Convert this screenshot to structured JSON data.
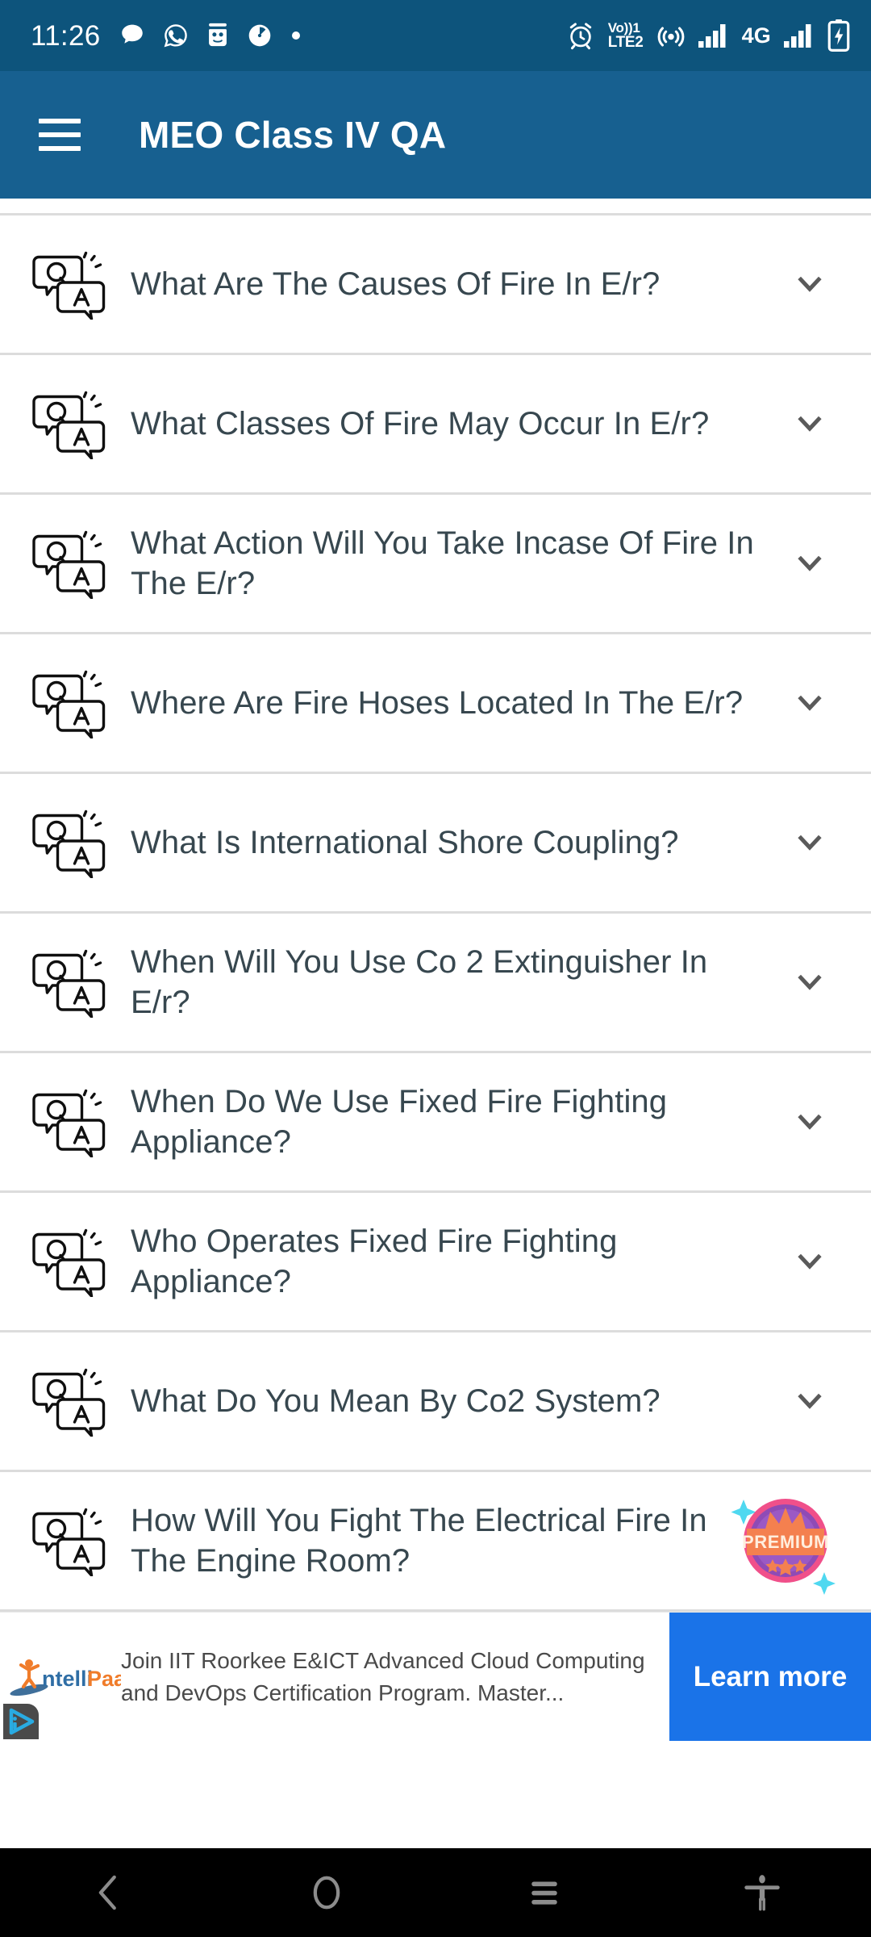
{
  "status_bar": {
    "time": "11:26",
    "left_icons": [
      "message-icon",
      "whatsapp-icon",
      "android-robot-icon",
      "speedometer-icon",
      "dot-icon"
    ],
    "right_icons": [
      "alarm-icon",
      "volte-icon",
      "hotspot-icon",
      "signal-bars-icon",
      "network-type",
      "signal-bars-2-icon",
      "battery-charging-icon"
    ],
    "volte_top": "Vo))1",
    "volte_bottom": "LTE2",
    "network_type": "4G",
    "background": "#0d547c"
  },
  "app_bar": {
    "menu_icon": "hamburger-menu-icon",
    "title": "MEO Class IV QA",
    "background": "#176090",
    "title_color": "#ffffff"
  },
  "list": {
    "item_icon": "qa-speech-bubbles-icon",
    "expand_icon": "chevron-down-icon",
    "text_color": "#37474f",
    "divider_color": "#dcdcdc",
    "items": [
      {
        "question": "What Are The Causes Of Fire In E/r?",
        "trailing": "chevron"
      },
      {
        "question": "What Classes Of Fire May Occur In E/r?",
        "trailing": "chevron"
      },
      {
        "question": "What Action Will You Take Incase Of Fire In The E/r?",
        "trailing": "chevron"
      },
      {
        "question": "Where Are Fire Hoses Located In The E/r?",
        "trailing": "chevron"
      },
      {
        "question": "What Is International Shore Coupling?",
        "trailing": "chevron"
      },
      {
        "question": "When Will You Use Co 2 Extinguisher In E/r?",
        "trailing": "chevron"
      },
      {
        "question": "When Do We Use Fixed Fire Fighting Appliance?",
        "trailing": "chevron"
      },
      {
        "question": "Who Operates Fixed Fire Fighting Appliance?",
        "trailing": "chevron"
      },
      {
        "question": "What Do You Mean By Co2 System?",
        "trailing": "chevron"
      },
      {
        "question": "How Will You Fight The Electrical Fire In The Engine Room?",
        "trailing": "premium"
      }
    ]
  },
  "premium_badge": {
    "label": "PREMIUM",
    "circle_color": "#9b59c4",
    "ring_color": "#f0508a",
    "banner_color": "#f4804f",
    "crown_color": "#f4804f",
    "sparkle_color": "#4fd8f0"
  },
  "ad": {
    "advertiser": "IntelliPaat",
    "logo_text_primary": "ntelli",
    "logo_text_secondary": "Paat",
    "headline_line1": "Join IIT Roorkee E&ICT Advanced Cloud Computing",
    "headline_line2": "and DevOps Certification Program. Master...",
    "cta_label": "Learn more",
    "cta_color": "#1a73e8",
    "adchoices_icon": "adchoices-icon"
  },
  "nav_bar": {
    "background": "#000000",
    "icon_color": "#8c8c8c",
    "buttons": [
      {
        "name": "back-button",
        "icon": "chevron-left-icon"
      },
      {
        "name": "home-button",
        "icon": "circle-icon"
      },
      {
        "name": "recents-button",
        "icon": "menu-lines-icon"
      },
      {
        "name": "accessibility-button",
        "icon": "accessibility-person-icon"
      }
    ]
  }
}
